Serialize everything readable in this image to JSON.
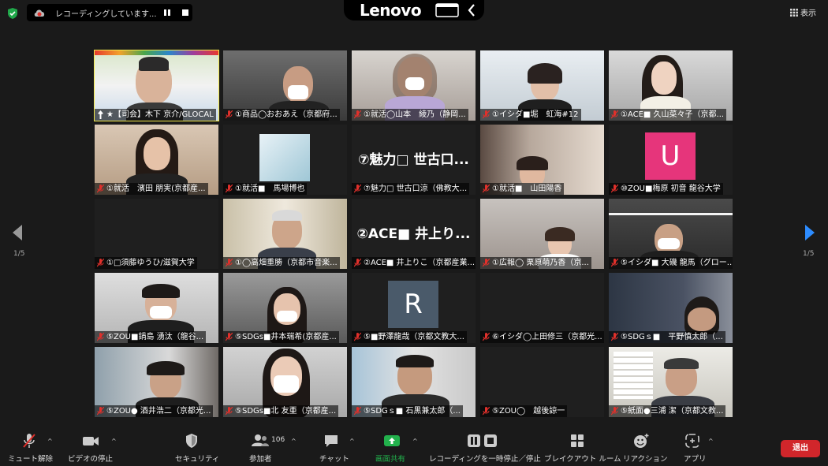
{
  "recording": {
    "status_text": "レコーディングしています..."
  },
  "brand": {
    "name": "Lenovo"
  },
  "view_button": {
    "label": "表示"
  },
  "pagination": {
    "left_label": "1/5",
    "right_label": "1/5"
  },
  "participants": [
    {
      "name": "★【司会】木下 京介/GLOCAL",
      "host": true
    },
    {
      "name": "①商品◯おおあえ（京都府..."
    },
    {
      "name": "①就活◯山本　綾乃（静岡..."
    },
    {
      "name": "①イシダ■堀　虹海#12"
    },
    {
      "name": "①ACE■ 久山菜々子（京都..."
    },
    {
      "name": "①就活　濱田 朋実(京都産..."
    },
    {
      "name": "①就活■　馬場博也"
    },
    {
      "name": "⑦魅力□ 世古口涼（佛教大...",
      "big_text": "⑦魅力□ 世古口..."
    },
    {
      "name": "①就活■　山田陽香"
    },
    {
      "name": "⑩ZOU■梅原 初音  龍谷大学",
      "avatar_letter": "U"
    },
    {
      "name": "①□須藤ゆうひ/滋賀大学"
    },
    {
      "name": "①◯高畑重勝（京都市音楽..."
    },
    {
      "name": "②ACE■ 井上りこ（京都産業...",
      "big_text": "②ACE■ 井上り..."
    },
    {
      "name": "①広報◯ 栗原萌乃香（京..."
    },
    {
      "name": "⑤イシダ■ 大磯 龍馬（グロー..."
    },
    {
      "name": "⑤ZOU■鍋島 湧汰（龍谷..."
    },
    {
      "name": "⑤SDGs■井本瑞希(京都産..."
    },
    {
      "name": "⑤■野澤龍哉（京都文教大...",
      "avatar_letter": "R"
    },
    {
      "name": "⑥イシダ◯上田修三（京都光..."
    },
    {
      "name": "⑤SDGｓ■　平野慎太郎（..."
    },
    {
      "name": "⑤ZOU●  酒井浩二（京都光..."
    },
    {
      "name": "⑤SDGs■北 友亜（京都産..."
    },
    {
      "name": "⑤SDGｓ■  石黒兼太郎（..."
    },
    {
      "name": "⑤ZOU◯　越後諒一"
    },
    {
      "name": "⑤紙面●三浦 潔（京都文教..."
    }
  ],
  "toolbar": {
    "unmute": "ミュート解除",
    "stop_video": "ビデオの停止",
    "security": "セキュリティ",
    "participants": "参加者",
    "participant_count": "106",
    "chat": "チャット",
    "share_screen": "画面共有",
    "recording": "レコーディングを一時停止／停止",
    "breakout": "ブレイクアウト ルーム",
    "reactions": "リアクション",
    "apps": "アプリ",
    "leave": "退出"
  },
  "colors": {
    "background": "#1a1a1a",
    "active_speaker": "#f2e84b",
    "share_green": "#22b14c",
    "leave_red": "#d1262b",
    "mic_muted_red": "#e0302b",
    "nav_arrow_blue": "#2d8cff"
  }
}
